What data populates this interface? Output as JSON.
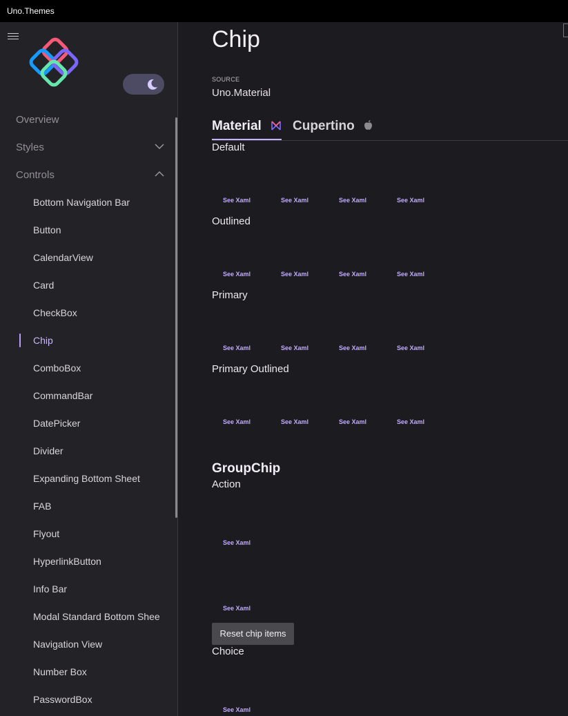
{
  "app": {
    "title": "Uno.Themes"
  },
  "sidebar": {
    "top_items": [
      {
        "label": "Overview"
      },
      {
        "label": "Styles"
      },
      {
        "label": "Controls"
      }
    ],
    "control_items": [
      {
        "label": "Bottom Navigation Bar"
      },
      {
        "label": "Button"
      },
      {
        "label": "CalendarView"
      },
      {
        "label": "Card"
      },
      {
        "label": "CheckBox"
      },
      {
        "label": "Chip",
        "selected": true
      },
      {
        "label": "ComboBox"
      },
      {
        "label": "CommandBar"
      },
      {
        "label": "DatePicker"
      },
      {
        "label": "Divider"
      },
      {
        "label": "Expanding Bottom Sheet"
      },
      {
        "label": "FAB"
      },
      {
        "label": "Flyout"
      },
      {
        "label": "HyperlinkButton"
      },
      {
        "label": "Info Bar"
      },
      {
        "label": "Modal Standard Bottom Shee"
      },
      {
        "label": "Navigation View"
      },
      {
        "label": "Number Box"
      },
      {
        "label": "PasswordBox"
      }
    ],
    "theme_toggle_icon": "moon-icon"
  },
  "page": {
    "title": "Chip",
    "source_label": "SOURCE",
    "source_value": "Uno.Material"
  },
  "tabs": [
    {
      "label": "Material",
      "icon": "material-icon",
      "active": true
    },
    {
      "label": "Cupertino",
      "icon": "apple-icon",
      "active": false
    }
  ],
  "chip_sections": [
    {
      "title": "Default",
      "link": "See Xaml"
    },
    {
      "title": "Outlined",
      "link": "See Xaml"
    },
    {
      "title": "Primary",
      "link": "See Xaml"
    },
    {
      "title": "Primary Outlined",
      "link": "See Xaml"
    }
  ],
  "group_chip": {
    "heading": "GroupChip",
    "action_title": "Action",
    "action_link_1": "See Xaml",
    "action_link_2": "See Xaml",
    "reset_label": "Reset chip items",
    "choice_title": "Choice",
    "choice_link": "See Xaml"
  },
  "colors": {
    "accent": "#c4b2ff",
    "background": "#1c1b1f",
    "sidebar": "#232226"
  }
}
